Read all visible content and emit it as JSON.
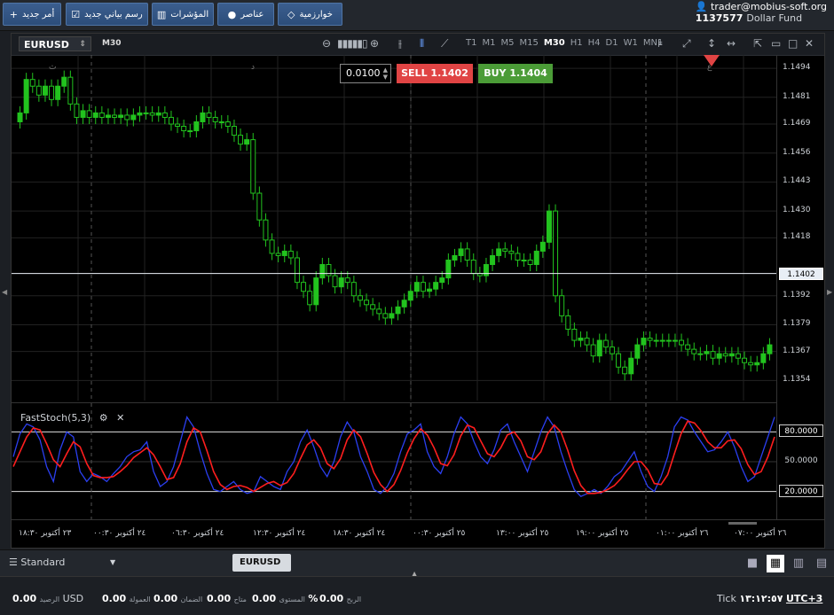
{
  "toolbar": {
    "buttons": [
      {
        "label": "أمر جديد",
        "icon": "+"
      },
      {
        "label": "رسم بياني جديد",
        "icon": "☑"
      },
      {
        "label": "المؤشرات",
        "icon": "▥"
      },
      {
        "label": "عناصر",
        "icon": "●"
      },
      {
        "label": "خوارزمية",
        "icon": "◇"
      }
    ]
  },
  "account": {
    "user": "trader@mobius-soft.org",
    "number": "1137577",
    "fund": "Dollar Fund",
    "user_icon": "user-icon"
  },
  "chart": {
    "symbol": "EURUSD",
    "timeframe": "M30",
    "timeframes": [
      "T1",
      "M1",
      "M5",
      "M15",
      "M30",
      "H1",
      "H4",
      "D1",
      "W1",
      "MN1"
    ],
    "active_timeframe": "M30",
    "lot": "0.0100",
    "sell_label": "SELL 1.1402",
    "buy_label": "BUY 1.1404",
    "current_price": "1.1402",
    "price_labels": [
      "1.1494",
      "1.1481",
      "1.1469",
      "1.1456",
      "1.1443",
      "1.1430",
      "1.1418",
      "1.1392",
      "1.1379",
      "1.1367",
      "1.1354"
    ],
    "session_marks": [
      "ث",
      "د",
      "ع"
    ],
    "time_labels": [
      "٢٣ أكتوبر ١٨:٣٠",
      "٢٤ أكتوبر ٠٠:٣٠",
      "٢٤ أكتوبر ٠٦:٣٠",
      "٢٤ أكتوبر ١٢:٣٠",
      "٢٤ أكتوبر ١٨:٣٠",
      "٢٥ أكتوبر ٠٠:٣٠",
      "٢٥ أكتوبر ١٣:٠٠",
      "٢٥ أكتوبر ١٩:٠٠",
      "٢٦ أكتوبر ٠١:٠٠",
      "٢٦ أكتوبر ٠٧:٠٠"
    ],
    "colors": {
      "bull": "#22c31e",
      "bear": "#22c31e",
      "sell": "#e04444",
      "buy": "#4b9c37"
    }
  },
  "indicator": {
    "name": "FastStoch(5,3)",
    "levels": [
      "80.0000",
      "50.0000",
      "20.0000"
    ]
  },
  "tabs": {
    "layout": "Standard",
    "open_tab": "EURUSD"
  },
  "status": {
    "currency": "USD",
    "balance_label": "الرصيد",
    "balance": "0.00",
    "commission_label": "العمولة",
    "commission": "0.00",
    "margin_label": "الضمان",
    "margin": "0.00",
    "free_label": "متاح",
    "free": "0.00",
    "level_label": "المستوى",
    "level": "0.00",
    "profit_label": "الربح",
    "profit": "0.00",
    "percent": "%",
    "tick": "Tick",
    "time": "١٣:١٢:٥٧",
    "timezone": "UTC+3"
  },
  "chart_data": {
    "type": "candlestick",
    "ylim": [
      1.1345,
      1.15
    ],
    "closes": [
      1.1474,
      1.1489,
      1.1486,
      1.1482,
      1.1486,
      1.148,
      1.1486,
      1.149,
      1.1478,
      1.1472,
      1.1475,
      1.1472,
      1.1474,
      1.1472,
      1.1473,
      1.1472,
      1.1473,
      1.1471,
      1.1473,
      1.1474,
      1.1474,
      1.1473,
      1.1474,
      1.1472,
      1.1469,
      1.1468,
      1.1466,
      1.1466,
      1.147,
      1.1474,
      1.1472,
      1.147,
      1.147,
      1.1468,
      1.1464,
      1.146,
      1.1462,
      1.1438,
      1.1426,
      1.1417,
      1.1411,
      1.141,
      1.1412,
      1.1409,
      1.1398,
      1.1394,
      1.1388,
      1.14,
      1.1406,
      1.1401,
      1.1396,
      1.14,
      1.1398,
      1.1392,
      1.139,
      1.1388,
      1.1386,
      1.1384,
      1.1382,
      1.1384,
      1.1387,
      1.139,
      1.1394,
      1.1398,
      1.1394,
      1.1395,
      1.1398,
      1.14,
      1.1408,
      1.141,
      1.1413,
      1.1408,
      1.1402,
      1.1401,
      1.1406,
      1.141,
      1.1413,
      1.1412,
      1.1411,
      1.1408,
      1.1408,
      1.1406,
      1.1412,
      1.1416,
      1.143,
      1.1392,
      1.1383,
      1.1377,
      1.1372,
      1.1373,
      1.137,
      1.1365,
      1.1372,
      1.1369,
      1.1366,
      1.136,
      1.1357,
      1.1364,
      1.137,
      1.1373,
      1.1372,
      1.1372,
      1.1372,
      1.1372,
      1.1372,
      1.137,
      1.1368,
      1.1366,
      1.1366,
      1.1367,
      1.1364,
      1.1366,
      1.1365,
      1.1366,
      1.1364,
      1.1362,
      1.1361,
      1.1362,
      1.1366,
      1.137
    ],
    "k": [
      55,
      78,
      88,
      85,
      72,
      45,
      30,
      62,
      80,
      75,
      40,
      30,
      38,
      35,
      30,
      38,
      45,
      55,
      60,
      62,
      70,
      40,
      25,
      30,
      45,
      70,
      95,
      85,
      60,
      38,
      22,
      20,
      25,
      30,
      22,
      18,
      20,
      35,
      30,
      25,
      22,
      40,
      50,
      70,
      82,
      65,
      45,
      35,
      50,
      75,
      90,
      80,
      55,
      40,
      22,
      18,
      25,
      38,
      60,
      78,
      82,
      88,
      60,
      45,
      38,
      55,
      78,
      95,
      88,
      70,
      55,
      48,
      62,
      82,
      88,
      70,
      55,
      40,
      60,
      80,
      95,
      85,
      60,
      40,
      22,
      15,
      18,
      22,
      18,
      25,
      35,
      40,
      50,
      60,
      40,
      25,
      20,
      35,
      55,
      85,
      95,
      92,
      80,
      70,
      60,
      62,
      70,
      80,
      65,
      45,
      30,
      35,
      55,
      75,
      95
    ],
    "d": [
      45,
      60,
      75,
      84,
      82,
      68,
      52,
      45,
      58,
      70,
      65,
      48,
      36,
      34,
      34,
      35,
      40,
      46,
      54,
      59,
      64,
      57,
      45,
      32,
      34,
      48,
      70,
      84,
      80,
      61,
      40,
      27,
      22,
      25,
      26,
      24,
      20,
      24,
      28,
      30,
      26,
      29,
      38,
      53,
      67,
      72,
      64,
      48,
      43,
      53,
      72,
      82,
      75,
      58,
      39,
      27,
      20,
      27,
      41,
      59,
      73,
      83,
      77,
      64,
      48,
      46,
      57,
      76,
      87,
      84,
      71,
      58,
      55,
      64,
      77,
      80,
      71,
      55,
      52,
      60,
      78,
      87,
      80,
      62,
      41,
      26,
      18,
      18,
      19,
      22,
      26,
      33,
      42,
      50,
      50,
      42,
      28,
      27,
      37,
      58,
      78,
      91,
      89,
      81,
      70,
      64,
      64,
      71,
      72,
      63,
      47,
      37,
      40,
      55,
      75
    ]
  }
}
